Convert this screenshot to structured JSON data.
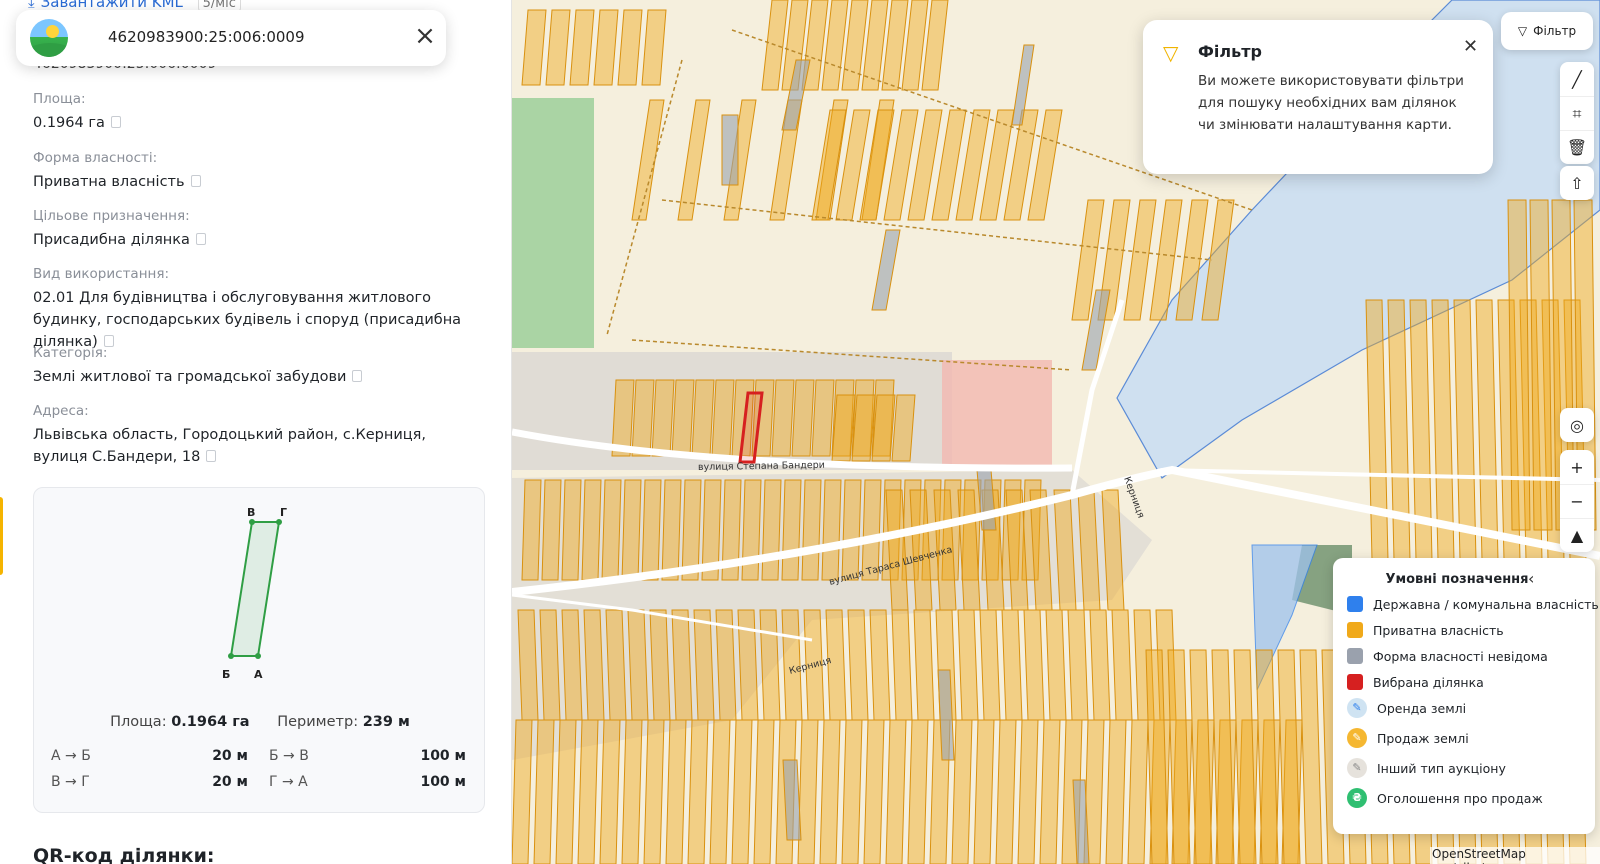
{
  "top_link": {
    "icon": "download-icon",
    "label": "Завантажити KML",
    "count": "5/міс"
  },
  "header": {
    "cadastral_number": "4620983900:25:006:0009",
    "close_icon": "close-icon",
    "logo": "app-logo"
  },
  "cadastral_number_under": "4620983900:25:006:0009",
  "properties": [
    {
      "label": "Площа:",
      "value": "0.1964 га"
    },
    {
      "label": "Форма власності:",
      "value": "Приватна власність"
    },
    {
      "label": "Цільове призначення:",
      "value": "Присадибна ділянка"
    },
    {
      "label": "Вид використання:",
      "value": "02.01 Для будівництва і обслуговування житлового будинку, господарських будівель і споруд (присадибна ділянка)"
    },
    {
      "label": "Категорія:",
      "value": "Землі житлової та громадської забудови"
    },
    {
      "label": "Адреса:",
      "value": "Львівська область, Городоцький район, с.Керниця, вулиця С.Бандери, 18"
    }
  ],
  "plot": {
    "vertices": {
      "a": "А",
      "b": "Б",
      "v": "В",
      "g": "Г"
    },
    "area_label": "Площа:",
    "area_value": "0.1964 га",
    "perimeter_label": "Периметр:",
    "perimeter_value": "239 м",
    "edges": [
      {
        "name": "А → Б",
        "length": "20 м"
      },
      {
        "name": "Б → В",
        "length": "100 м"
      },
      {
        "name": "В → Г",
        "length": "20 м"
      },
      {
        "name": "Г → А",
        "length": "100 м"
      }
    ]
  },
  "qr_title": "QR-код ділянки:",
  "filter_popup": {
    "icon": "filter-icon",
    "title": "Фільтр",
    "text": "Ви можете використовувати фільтри для пошуку необхідних вам ділянок чи змінювати налаштування карти.",
    "close_icon": "close-icon"
  },
  "filter_button": {
    "icon": "filter-icon",
    "label": "Фільтр"
  },
  "tools": [
    "ruler-icon",
    "polygon-icon",
    "trash-icon",
    "share-icon"
  ],
  "zoom_tools": [
    "locate-icon",
    "zoom-in-icon",
    "zoom-out-icon",
    "compass-icon"
  ],
  "map_labels": {
    "street1": "вулиця Степана Бандери",
    "street2": "вулиця Тараса Шевченка",
    "street3": "Керниця",
    "street4": "Керниця"
  },
  "legend": {
    "title": "Умовні позначення",
    "items": [
      {
        "label": "Державна / комунальна власність",
        "color": "#2f80ed",
        "kind": "square"
      },
      {
        "label": "Приватна власність",
        "color": "#f0a91a",
        "kind": "square"
      },
      {
        "label": "Форма власності невідома",
        "color": "#9aa1ad",
        "kind": "square"
      },
      {
        "label": "Вибрана ділянка",
        "color": "#d62020",
        "kind": "square"
      },
      {
        "label": "Оренда землі",
        "color": "#cfe3f2",
        "kind": "circle",
        "icon": "rent-icon"
      },
      {
        "label": "Продаж землі",
        "color": "#f5b731",
        "kind": "circle",
        "icon": "sale-icon"
      },
      {
        "label": "Інший тип аукціону",
        "color": "#e6e2dc",
        "kind": "circle",
        "icon": "auction-icon"
      },
      {
        "label": "Оголошення про продаж",
        "color": "#2fbf71",
        "kind": "circle",
        "icon": "hryvnia-icon",
        "symbol": "₴"
      }
    ]
  },
  "attribution": "OpenStreetMap contributors",
  "colors": {
    "private": "#f0a91a",
    "state": "#2f80ed",
    "unknown": "#9aa1ad",
    "selected": "#d62020",
    "plot_outline": "#2f9e44",
    "accent": "#f5b400"
  }
}
